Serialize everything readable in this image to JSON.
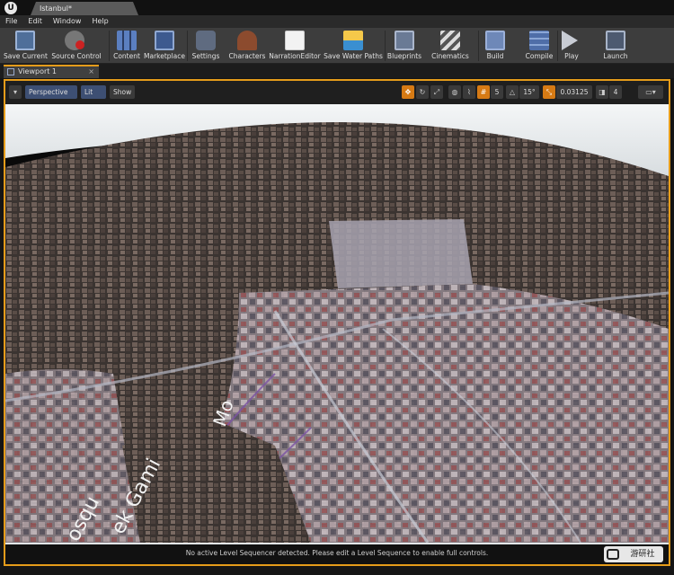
{
  "window": {
    "tab_title": "Istanbul*"
  },
  "menu": [
    "File",
    "Edit",
    "Window",
    "Help"
  ],
  "toolbar": {
    "save_current": "Save Current",
    "source_control": "Source Control",
    "content": "Content",
    "marketplace": "Marketplace",
    "settings": "Settings",
    "characters": "Characters",
    "narration_editor": "NarrationEditor",
    "save_water_paths": "Save Water Paths",
    "blueprints": "Blueprints",
    "cinematics": "Cinematics",
    "build": "Build",
    "compile": "Compile",
    "play": "Play",
    "launch": "Launch"
  },
  "viewport": {
    "tab_label": "Viewport 1",
    "perspective": "Perspective",
    "lit": "Lit",
    "show": "Show",
    "grid_snap": "5",
    "rot_snap": "15°",
    "scale_snap": "0.03125",
    "cam_speed": "4",
    "status_message": "No active Level Sequencer detected. Please edit a Level Sequence to enable full controls."
  },
  "scene_labels": {
    "road_label_1": "Mo",
    "road_label_2": "ek Gami",
    "road_label_3": "osqu"
  },
  "watermark": "游研社",
  "colors": {
    "accent": "#e59c1a",
    "lit_blue": "#3d4f73"
  }
}
